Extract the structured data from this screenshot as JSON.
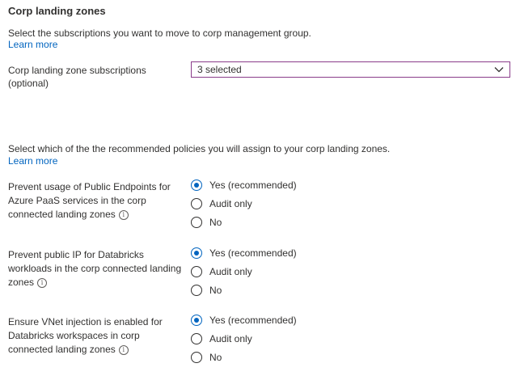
{
  "section": {
    "title": "Corp landing zones",
    "description": "Select the subscriptions you want to move to corp management group.",
    "learn_more": "Learn more"
  },
  "subscriptions": {
    "label": "Corp landing zone subscriptions (optional)",
    "selected_value": "3 selected"
  },
  "policies_section": {
    "description": "Select which of the the recommended policies you will assign to your corp landing zones.",
    "learn_more": "Learn more"
  },
  "policies": [
    {
      "label": "Prevent usage of Public Endpoints for Azure PaaS services in the corp connected landing zones",
      "options": [
        "Yes (recommended)",
        "Audit only",
        "No"
      ],
      "selected": "Yes (recommended)"
    },
    {
      "label": "Prevent public IP for Databricks workloads in the corp connected landing zones",
      "options": [
        "Yes (recommended)",
        "Audit only",
        "No"
      ],
      "selected": "Yes (recommended)"
    },
    {
      "label": "Ensure VNet injection is enabled for Databricks workspaces in corp connected landing zones",
      "options": [
        "Yes (recommended)",
        "Audit only",
        "No"
      ],
      "selected": "Yes (recommended)"
    }
  ],
  "icons": {
    "info": "info-icon",
    "dropdown": "chevron-down-icon"
  },
  "colors": {
    "link": "#0064bf",
    "radio_selected": "#0064bf",
    "dropdown_border": "#8a3c8a",
    "text": "#323130"
  }
}
